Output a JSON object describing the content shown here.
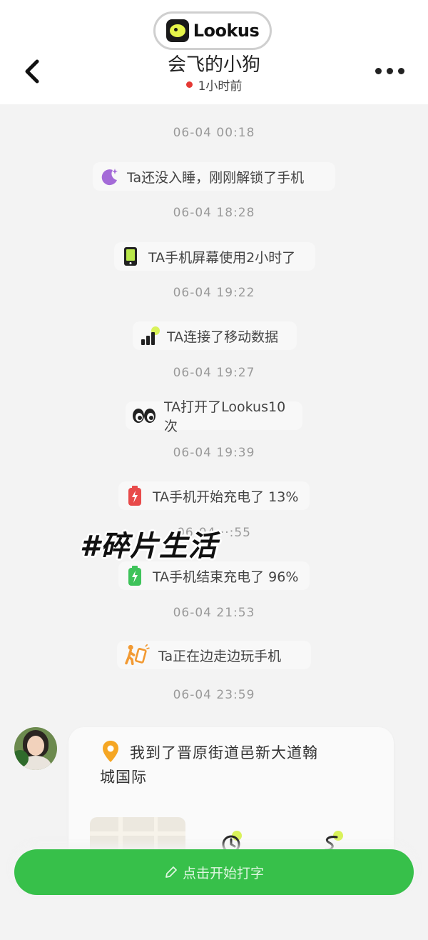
{
  "brand": {
    "name": "Lookus",
    "logo_icon": "lookus-logo-icon"
  },
  "header": {
    "back_icon": "chevron-left-icon",
    "more_icon": "more-dots-icon",
    "contact_name": "会飞的小狗",
    "presence": "1小时前",
    "presence_color": "#e53935"
  },
  "feed": [
    {
      "time": "06-04 00:18",
      "event": "Ta还没入睡，刚刚解锁了手机",
      "icon": "moon-icon"
    },
    {
      "time": "06-04 18:28",
      "event": "TA手机屏幕使用2小时了",
      "icon": "phone-screen-icon"
    },
    {
      "time": "06-04 19:22",
      "event": "TA连接了移动数据",
      "icon": "signal-bars-icon"
    },
    {
      "time": "06-04 19:27",
      "event": "TA打开了Lookus10次",
      "icon": "eyes-icon"
    },
    {
      "time": "06-04 19:39",
      "event": "TA手机开始充电了 13%",
      "icon": "battery-low-icon"
    },
    {
      "time": "06-04 ··:55",
      "event": "TA手机结束充电了 96%",
      "icon": "battery-full-icon"
    },
    {
      "time": "06-04 21:53",
      "event": "Ta正在边走边玩手机",
      "icon": "walking-phone-icon"
    },
    {
      "time": "06-04 23:59"
    }
  ],
  "overlay_text": "#碎片生活",
  "location_card": {
    "line1": "我到了晋原街道邑新大道翰",
    "line2": "城国际",
    "pin_icon": "location-pin-icon",
    "map_icon": "map-thumbnail",
    "icons": [
      "clock-icon",
      "route-icon"
    ]
  },
  "compose": {
    "label": "点击开始打字",
    "icon": "pencil-icon"
  },
  "colors": {
    "accent": "#37c04a",
    "moon": "#a46bd8",
    "battery_low": "#e84b4b",
    "battery_full": "#3ec35a",
    "pin": "#f5a623"
  }
}
